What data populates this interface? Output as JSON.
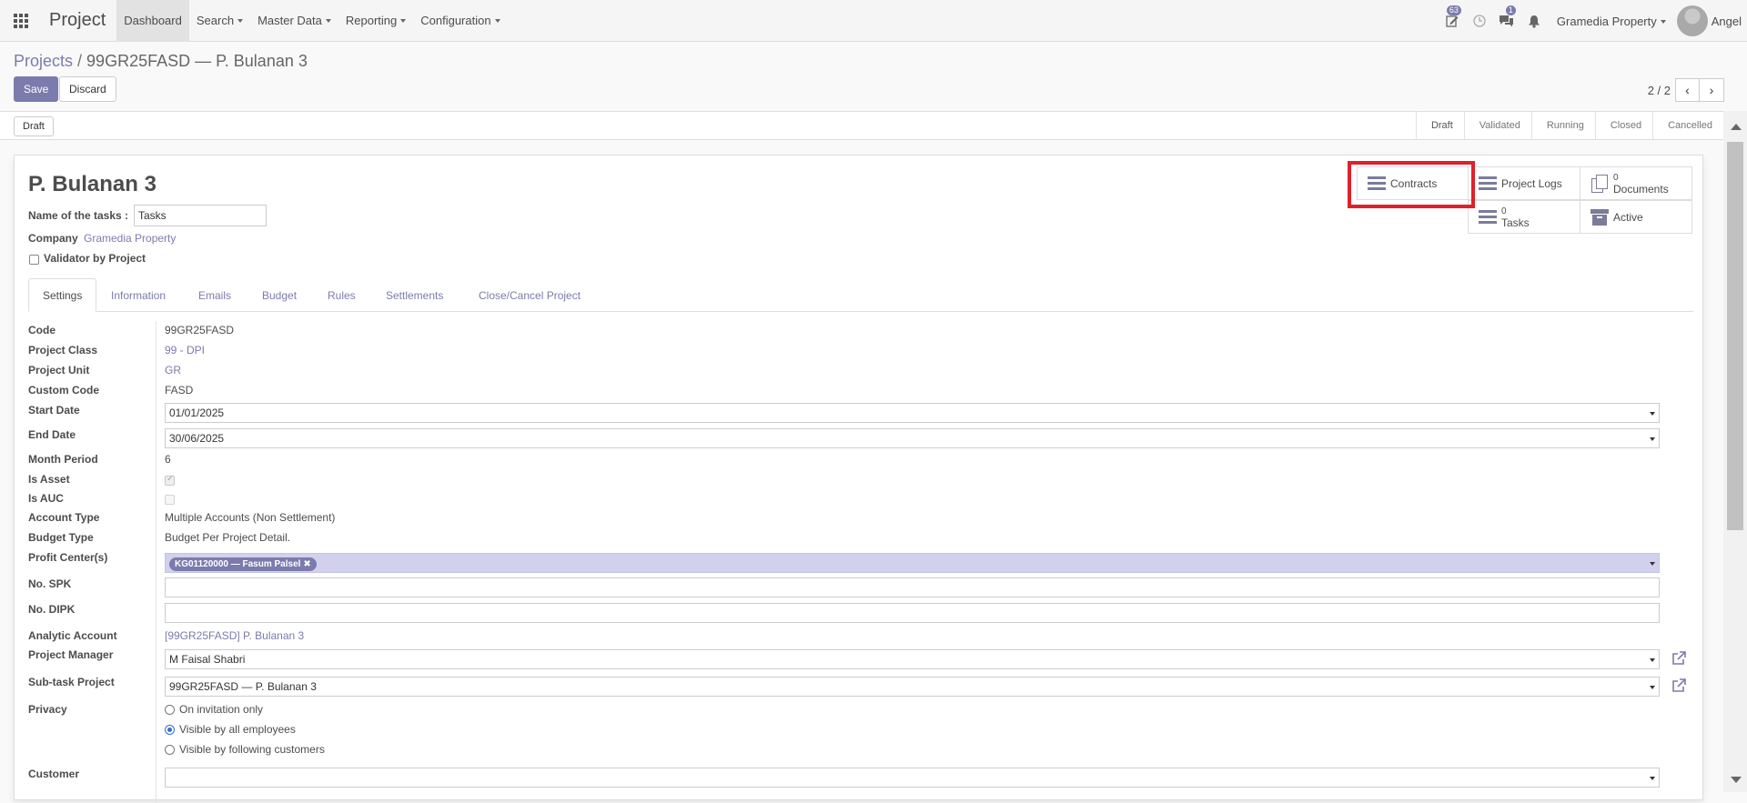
{
  "navbar": {
    "brand": "Project",
    "menu": [
      {
        "label": "Dashboard",
        "caret": false,
        "active": true
      },
      {
        "label": "Search",
        "caret": true
      },
      {
        "label": "Master Data",
        "caret": true
      },
      {
        "label": "Reporting",
        "caret": true
      },
      {
        "label": "Configuration",
        "caret": true
      }
    ],
    "activity_badge": "63",
    "messages_badge": "1",
    "company": "Gramedia Property",
    "user": "Angel"
  },
  "breadcrumb": {
    "parent": "Projects",
    "separator": "/",
    "current": "99GR25FASD — P. Bulanan 3"
  },
  "buttons": {
    "save": "Save",
    "discard": "Discard"
  },
  "pager": {
    "value": "2 / 2",
    "prev": "‹",
    "next": "›"
  },
  "statusbar": {
    "button": "Draft",
    "stages": [
      "Draft",
      "Validated",
      "Running",
      "Closed",
      "Cancelled"
    ]
  },
  "form": {
    "title": "P. Bulanan 3",
    "tasks_label": "Name of the tasks :",
    "tasks_value": "Tasks",
    "company_label": "Company",
    "company_value": "Gramedia Property",
    "validator_label": "Validator by Project"
  },
  "smart_buttons": {
    "contracts": "Contracts",
    "project_logs": "Project Logs",
    "documents_count": "0",
    "documents": "Documents",
    "tasks_count": "0",
    "tasks": "Tasks",
    "active": "Active"
  },
  "tabs": [
    "Settings",
    "Information",
    "Emails",
    "Budget",
    "Rules",
    "Settlements",
    "Close/Cancel Project"
  ],
  "fields": {
    "code_label": "Code",
    "code": "99GR25FASD",
    "class_label": "Project Class",
    "class": "99 - DPI",
    "unit_label": "Project Unit",
    "unit": "GR",
    "custom_label": "Custom Code",
    "custom": "FASD",
    "start_label": "Start Date",
    "start": "01/01/2025",
    "end_label": "End Date",
    "end": "30/06/2025",
    "month_label": "Month Period",
    "month": "6",
    "asset_label": "Is Asset",
    "auc_label": "Is AUC",
    "account_type_label": "Account Type",
    "account_type": "Multiple Accounts (Non Settlement)",
    "budget_type_label": "Budget Type",
    "budget_type": "Budget Per Project Detail.",
    "profit_label": "Profit Center(s)",
    "profit_tag": "KG01120000 — Fasum Palsel",
    "spk_label": "No. SPK",
    "dipk_label": "No. DIPK",
    "analytic_label": "Analytic Account",
    "analytic": "[99GR25FASD] P. Bulanan 3",
    "manager_label": "Project Manager",
    "manager": "M Faisal Shabri",
    "subtask_label": "Sub-task Project",
    "subtask": "99GR25FASD — P. Bulanan 3",
    "privacy_label": "Privacy",
    "privacy_options": [
      "On invitation only",
      "Visible by all employees",
      "Visible by following customers"
    ],
    "customer_label": "Customer"
  },
  "colors": {
    "primary": "#7c7bad",
    "highlight": "#e0202b",
    "active": "#3c8b3c"
  }
}
